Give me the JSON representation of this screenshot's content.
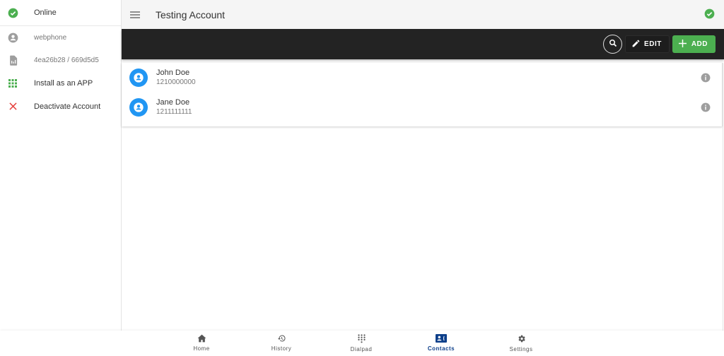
{
  "sidebar": {
    "items": [
      {
        "label": "Online",
        "icon": "check-circle-icon",
        "color": "#4caf50"
      },
      {
        "label": "webphone",
        "icon": "account-circle-icon",
        "color": "#9e9e9e"
      },
      {
        "label": "4ea26b28 / 669d5d5",
        "icon": "sim-card-icon",
        "color": "#9e9e9e"
      },
      {
        "label": "Install as an APP",
        "icon": "apps-grid-icon",
        "color": "#4caf50"
      },
      {
        "label": "Deactivate Account",
        "icon": "close-icon",
        "color": "#e53935"
      }
    ]
  },
  "header": {
    "title": "Testing Account",
    "menu_icon": "hamburger-icon",
    "status_icon": "check-circle-icon"
  },
  "toolbar": {
    "search_icon": "search-icon",
    "edit_label": "EDIT",
    "add_label": "ADD",
    "accent": "#4caf50"
  },
  "contacts": [
    {
      "name": "John Doe",
      "phone": "1210000000"
    },
    {
      "name": "Jane Doe",
      "phone": "1211111111"
    }
  ],
  "bottom_nav": {
    "items": [
      {
        "label": "Home",
        "icon": "home-icon"
      },
      {
        "label": "History",
        "icon": "history-icon"
      },
      {
        "label": "Dialpad",
        "icon": "dialpad-icon"
      },
      {
        "label": "Contacts",
        "icon": "contacts-icon",
        "active": true
      },
      {
        "label": "Settings",
        "icon": "gear-icon"
      }
    ],
    "active_color": "#0d3f8a"
  }
}
